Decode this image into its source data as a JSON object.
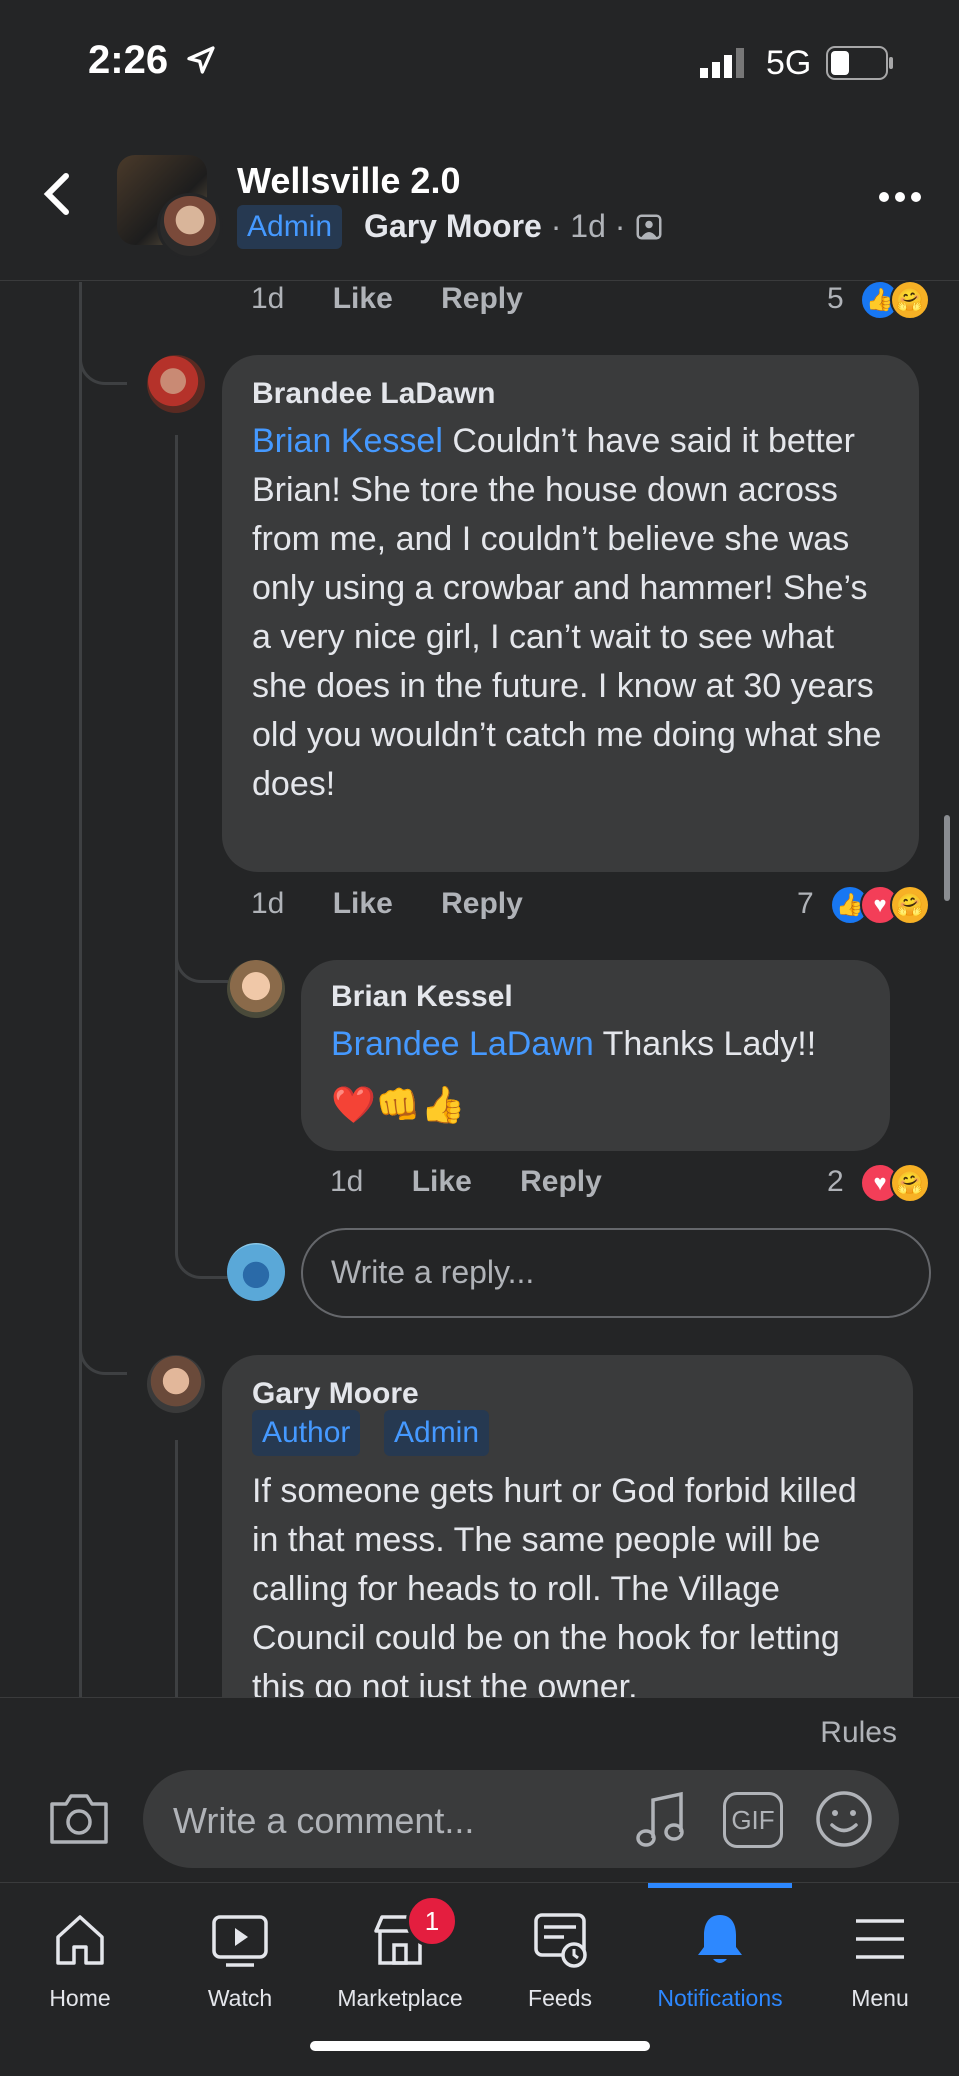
{
  "status": {
    "time": "2:26",
    "network": "5G"
  },
  "header": {
    "group_name": "Wellsville 2.0",
    "badge": "Admin",
    "author": "Gary Moore",
    "separator": "·",
    "age": "1d"
  },
  "top_meta": {
    "age": "1d",
    "like": "Like",
    "reply": "Reply",
    "reactions": "5"
  },
  "comments": [
    {
      "name": "Brandee LaDawn",
      "mention": "Brian Kessel",
      "text": "Couldn’t have said it better Brian! She tore the house down across from me, and I couldn’t believe she was only using a crowbar and hammer! She’s a very nice girl, I can’t wait to see what she does in the future. I know at 30 years old you wouldn’t catch me doing what she does!",
      "age": "1d",
      "like": "Like",
      "reply": "Reply",
      "reactions": "7"
    },
    {
      "name": "Brian Kessel",
      "mention": "Brandee LaDawn",
      "text": "Thanks Lady!!",
      "emoji": "❤️👊👍",
      "age": "1d",
      "like": "Like",
      "reply": "Reply",
      "reactions": "2"
    },
    {
      "name": "Gary Moore",
      "tags": [
        "Author",
        "Admin"
      ],
      "text": "If someone gets hurt or God forbid killed in that mess. The same people will be calling for heads to roll. The Village Council could be on the hook for letting this go not just the owner."
    }
  ],
  "reply_placeholder": "Write a reply...",
  "composer": {
    "rules": "Rules",
    "placeholder": "Write a comment...",
    "gif": "GIF"
  },
  "tabs": [
    {
      "label": "Home",
      "icon": "home-icon"
    },
    {
      "label": "Watch",
      "icon": "watch-icon"
    },
    {
      "label": "Marketplace",
      "icon": "marketplace-icon",
      "badge": "1"
    },
    {
      "label": "Feeds",
      "icon": "feeds-icon"
    },
    {
      "label": "Notifications",
      "icon": "bell-icon",
      "active": true
    },
    {
      "label": "Menu",
      "icon": "menu-icon"
    }
  ],
  "colors": {
    "background": "#242526",
    "bubble": "#3a3b3c",
    "accent": "#2d88ff",
    "mention": "#4599ff"
  }
}
